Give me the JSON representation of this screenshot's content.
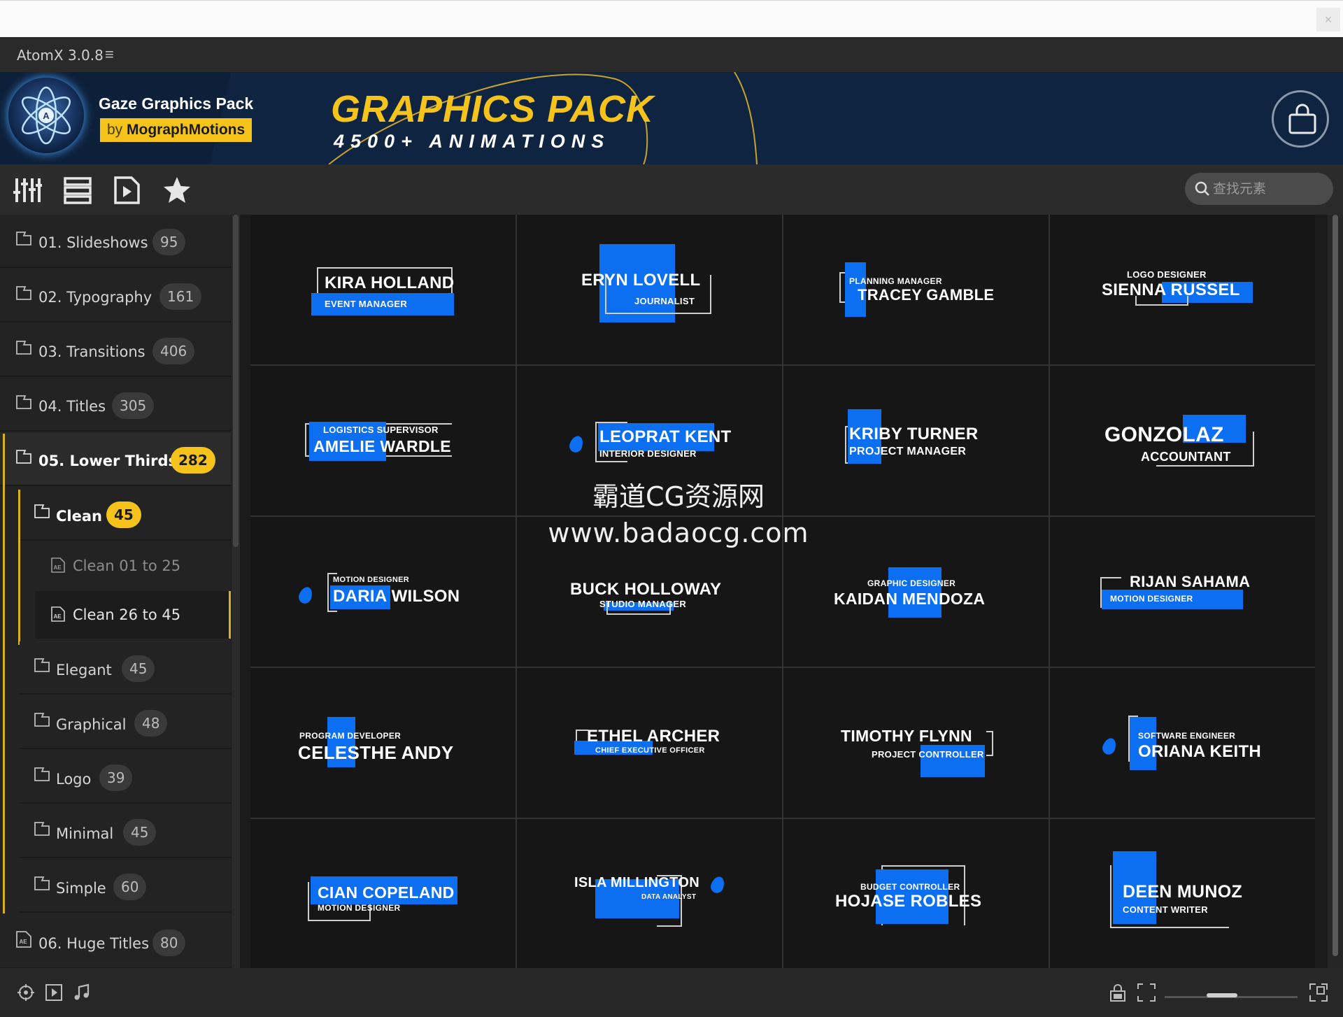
{
  "app": {
    "title": "AtomX 3.0.8",
    "close_glyph": "×"
  },
  "banner": {
    "pack_name": "Gaze Graphics Pack",
    "by_prefix": "by ",
    "by_name": "MographMotions",
    "headline": "GRAPHICS PACK",
    "subline": "4500+ ANIMATIONS",
    "colors": {
      "background": "#0f2440",
      "accent": "#f5c31a"
    }
  },
  "toolbar": {
    "icons": [
      "sliders-icon",
      "list-view-icon",
      "preview-file-icon",
      "favorites-star-icon"
    ],
    "search_placeholder": "查找元素"
  },
  "sidebar": {
    "categories": [
      {
        "label": "01. Slideshows",
        "count": "95"
      },
      {
        "label": "02. Typography",
        "count": "161"
      },
      {
        "label": "03. Transitions",
        "count": "406"
      },
      {
        "label": "04. Titles",
        "count": "305"
      },
      {
        "label": "05. Lower Thirds",
        "count": "282",
        "active": true
      },
      {
        "label": "06. Huge Titles",
        "count": "80"
      }
    ],
    "subcategories": [
      {
        "label": "Clean",
        "count": "45",
        "active": true
      },
      {
        "label": "Elegant",
        "count": "45"
      },
      {
        "label": "Graphical",
        "count": "48"
      },
      {
        "label": "Logo",
        "count": "39"
      },
      {
        "label": "Minimal",
        "count": "45"
      },
      {
        "label": "Simple",
        "count": "60"
      }
    ],
    "leaves": [
      {
        "label": "Clean 01 to 25"
      },
      {
        "label": "Clean 26 to 45",
        "selected": true
      }
    ]
  },
  "grid": {
    "accent": "#0c6ef0",
    "items": [
      {
        "name": "KIRA HOLLAND",
        "role": "EVENT MANAGER"
      },
      {
        "name": "ERYN LOVELL",
        "role": "JOURNALIST"
      },
      {
        "name": "TRACEY GAMBLE",
        "role": "PLANNING MANAGER"
      },
      {
        "name": "SIENNA RUSSEL",
        "role": "LOGO DESIGNER"
      },
      {
        "name": "AMELIE WARDLE",
        "role": "LOGISTICS SUPERVISOR"
      },
      {
        "name": "LEOPRAT KENT",
        "role": "INTERIOR DESIGNER"
      },
      {
        "name": "KRIBY TURNER",
        "role": "PROJECT MANAGER"
      },
      {
        "name": "GONZOLAZ",
        "role": "ACCOUNTANT"
      },
      {
        "name": "DARIA WILSON",
        "role": "MOTION DESIGNER"
      },
      {
        "name": "BUCK HOLLOWAY",
        "role": "STUDIO MANAGER"
      },
      {
        "name": "KAIDAN MENDOZA",
        "role": "GRAPHIC DESIGNER"
      },
      {
        "name": "RIJAN SAHAMA",
        "role": "MOTION DESIGNER"
      },
      {
        "name": "CELESTHE ANDY",
        "role": "PROGRAM DEVELOPER"
      },
      {
        "name": "ETHEL ARCHER",
        "role": "CHIEF EXECUTIVE OFFICER"
      },
      {
        "name": "TIMOTHY FLYNN",
        "role": "PROJECT CONTROLLER"
      },
      {
        "name": "ORIANA KEITH",
        "role": "SOFTWARE ENGINEER"
      },
      {
        "name": "CIAN COPELAND",
        "role": "MOTION DESIGNER"
      },
      {
        "name": "ISLA MILLINGTON",
        "role": "DATA ANALYST"
      },
      {
        "name": "HOJASE ROBLES",
        "role": "BUDGET CONTROLLER"
      },
      {
        "name": "DEEN MUNOZ",
        "role": "CONTENT WRITER"
      }
    ]
  },
  "watermark": {
    "line1": "霸道CG资源网",
    "line2": "www.badaocg.com"
  },
  "statusbar": {
    "left_icons": [
      "target-icon",
      "play-box-icon",
      "music-note-icon"
    ],
    "right_icons": [
      "lock-icon",
      "fit-frame-icon",
      "fullscreen-icon"
    ]
  }
}
